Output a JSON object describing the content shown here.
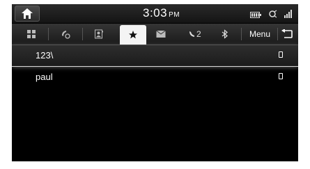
{
  "status_bar": {
    "time": "3:03",
    "ampm": "PM",
    "icons": [
      "battery-icon",
      "bluetooth-audio-icon",
      "signal-icon"
    ]
  },
  "tabs": [
    {
      "name": "tab-dial-pad",
      "icon": "grid-icon",
      "active": false
    },
    {
      "name": "tab-call-history",
      "icon": "phone-history-icon",
      "active": false
    },
    {
      "name": "tab-contacts",
      "icon": "contacts-icon",
      "active": false
    },
    {
      "name": "tab-favorites",
      "icon": "star-icon",
      "active": true
    },
    {
      "name": "tab-messages",
      "icon": "envelope-icon",
      "active": false
    }
  ],
  "call_indicator": {
    "count": "2"
  },
  "menu": {
    "label": "Menu"
  },
  "favorites": [
    {
      "name": "123\\",
      "selected": true
    },
    {
      "name": "paul",
      "selected": false
    }
  ]
}
